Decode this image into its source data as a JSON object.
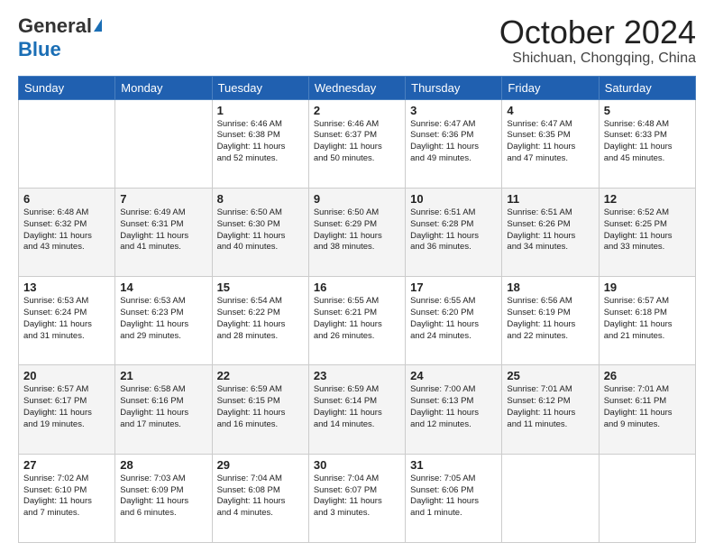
{
  "logo": {
    "general": "General",
    "blue": "Blue"
  },
  "title": {
    "month": "October 2024",
    "location": "Shichuan, Chongqing, China"
  },
  "headers": [
    "Sunday",
    "Monday",
    "Tuesday",
    "Wednesday",
    "Thursday",
    "Friday",
    "Saturday"
  ],
  "weeks": [
    [
      {
        "day": "",
        "info": ""
      },
      {
        "day": "",
        "info": ""
      },
      {
        "day": "1",
        "info": "Sunrise: 6:46 AM\nSunset: 6:38 PM\nDaylight: 11 hours\nand 52 minutes."
      },
      {
        "day": "2",
        "info": "Sunrise: 6:46 AM\nSunset: 6:37 PM\nDaylight: 11 hours\nand 50 minutes."
      },
      {
        "day": "3",
        "info": "Sunrise: 6:47 AM\nSunset: 6:36 PM\nDaylight: 11 hours\nand 49 minutes."
      },
      {
        "day": "4",
        "info": "Sunrise: 6:47 AM\nSunset: 6:35 PM\nDaylight: 11 hours\nand 47 minutes."
      },
      {
        "day": "5",
        "info": "Sunrise: 6:48 AM\nSunset: 6:33 PM\nDaylight: 11 hours\nand 45 minutes."
      }
    ],
    [
      {
        "day": "6",
        "info": "Sunrise: 6:48 AM\nSunset: 6:32 PM\nDaylight: 11 hours\nand 43 minutes."
      },
      {
        "day": "7",
        "info": "Sunrise: 6:49 AM\nSunset: 6:31 PM\nDaylight: 11 hours\nand 41 minutes."
      },
      {
        "day": "8",
        "info": "Sunrise: 6:50 AM\nSunset: 6:30 PM\nDaylight: 11 hours\nand 40 minutes."
      },
      {
        "day": "9",
        "info": "Sunrise: 6:50 AM\nSunset: 6:29 PM\nDaylight: 11 hours\nand 38 minutes."
      },
      {
        "day": "10",
        "info": "Sunrise: 6:51 AM\nSunset: 6:28 PM\nDaylight: 11 hours\nand 36 minutes."
      },
      {
        "day": "11",
        "info": "Sunrise: 6:51 AM\nSunset: 6:26 PM\nDaylight: 11 hours\nand 34 minutes."
      },
      {
        "day": "12",
        "info": "Sunrise: 6:52 AM\nSunset: 6:25 PM\nDaylight: 11 hours\nand 33 minutes."
      }
    ],
    [
      {
        "day": "13",
        "info": "Sunrise: 6:53 AM\nSunset: 6:24 PM\nDaylight: 11 hours\nand 31 minutes."
      },
      {
        "day": "14",
        "info": "Sunrise: 6:53 AM\nSunset: 6:23 PM\nDaylight: 11 hours\nand 29 minutes."
      },
      {
        "day": "15",
        "info": "Sunrise: 6:54 AM\nSunset: 6:22 PM\nDaylight: 11 hours\nand 28 minutes."
      },
      {
        "day": "16",
        "info": "Sunrise: 6:55 AM\nSunset: 6:21 PM\nDaylight: 11 hours\nand 26 minutes."
      },
      {
        "day": "17",
        "info": "Sunrise: 6:55 AM\nSunset: 6:20 PM\nDaylight: 11 hours\nand 24 minutes."
      },
      {
        "day": "18",
        "info": "Sunrise: 6:56 AM\nSunset: 6:19 PM\nDaylight: 11 hours\nand 22 minutes."
      },
      {
        "day": "19",
        "info": "Sunrise: 6:57 AM\nSunset: 6:18 PM\nDaylight: 11 hours\nand 21 minutes."
      }
    ],
    [
      {
        "day": "20",
        "info": "Sunrise: 6:57 AM\nSunset: 6:17 PM\nDaylight: 11 hours\nand 19 minutes."
      },
      {
        "day": "21",
        "info": "Sunrise: 6:58 AM\nSunset: 6:16 PM\nDaylight: 11 hours\nand 17 minutes."
      },
      {
        "day": "22",
        "info": "Sunrise: 6:59 AM\nSunset: 6:15 PM\nDaylight: 11 hours\nand 16 minutes."
      },
      {
        "day": "23",
        "info": "Sunrise: 6:59 AM\nSunset: 6:14 PM\nDaylight: 11 hours\nand 14 minutes."
      },
      {
        "day": "24",
        "info": "Sunrise: 7:00 AM\nSunset: 6:13 PM\nDaylight: 11 hours\nand 12 minutes."
      },
      {
        "day": "25",
        "info": "Sunrise: 7:01 AM\nSunset: 6:12 PM\nDaylight: 11 hours\nand 11 minutes."
      },
      {
        "day": "26",
        "info": "Sunrise: 7:01 AM\nSunset: 6:11 PM\nDaylight: 11 hours\nand 9 minutes."
      }
    ],
    [
      {
        "day": "27",
        "info": "Sunrise: 7:02 AM\nSunset: 6:10 PM\nDaylight: 11 hours\nand 7 minutes."
      },
      {
        "day": "28",
        "info": "Sunrise: 7:03 AM\nSunset: 6:09 PM\nDaylight: 11 hours\nand 6 minutes."
      },
      {
        "day": "29",
        "info": "Sunrise: 7:04 AM\nSunset: 6:08 PM\nDaylight: 11 hours\nand 4 minutes."
      },
      {
        "day": "30",
        "info": "Sunrise: 7:04 AM\nSunset: 6:07 PM\nDaylight: 11 hours\nand 3 minutes."
      },
      {
        "day": "31",
        "info": "Sunrise: 7:05 AM\nSunset: 6:06 PM\nDaylight: 11 hours\nand 1 minute."
      },
      {
        "day": "",
        "info": ""
      },
      {
        "day": "",
        "info": ""
      }
    ]
  ]
}
